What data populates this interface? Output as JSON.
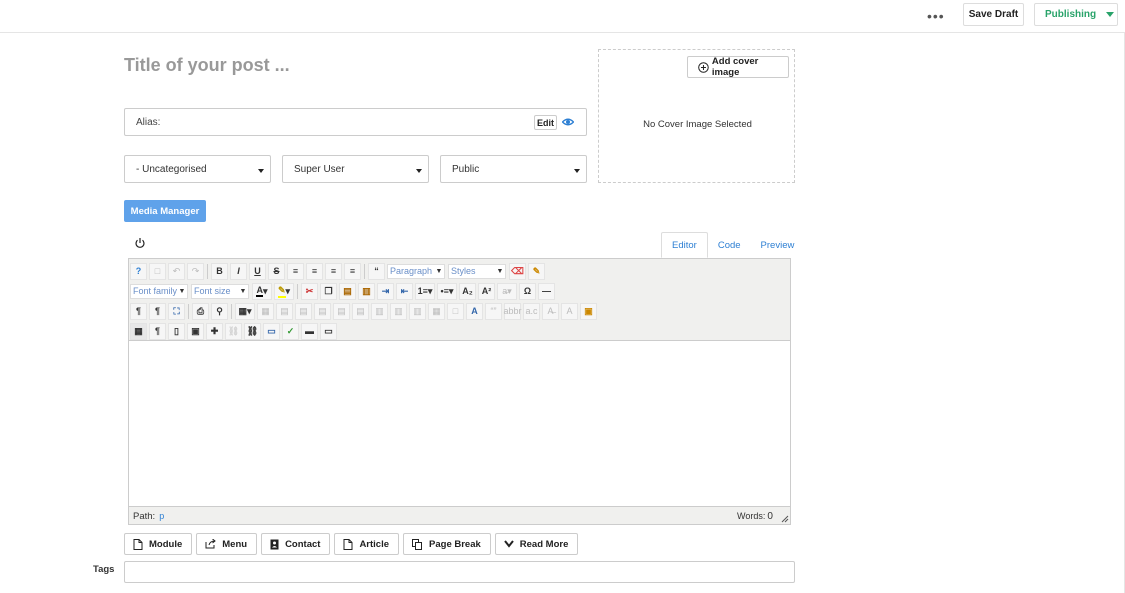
{
  "header": {
    "more_label": "•••",
    "save_draft": "Save Draft",
    "publishing": "Publishing"
  },
  "post": {
    "title_placeholder": "Title of your post ...",
    "alias_label": "Alias:",
    "alias_edit": "Edit",
    "category": "- Uncategorised",
    "author": "Super User",
    "access": "Public"
  },
  "cover": {
    "add_label": "Add cover image",
    "none_label": "No Cover Image Selected"
  },
  "media_manager": "Media Manager",
  "editor": {
    "tabs": [
      "Editor",
      "Code",
      "Preview"
    ],
    "active_tab": "Editor",
    "format_select": "Paragraph",
    "styles_select": "Styles",
    "font_family": "Font family",
    "font_size": "Font size",
    "path_label": "Path:",
    "path_value": "p",
    "words_label": "Words:",
    "words_count": "0"
  },
  "extension_buttons": [
    "Module",
    "Menu",
    "Contact",
    "Article",
    "Page Break",
    "Read More"
  ],
  "tags_label": "Tags",
  "colors": {
    "accent_blue": "#5fa2ea",
    "publish_green": "#29a36a",
    "link_blue": "#2d7fd3"
  }
}
